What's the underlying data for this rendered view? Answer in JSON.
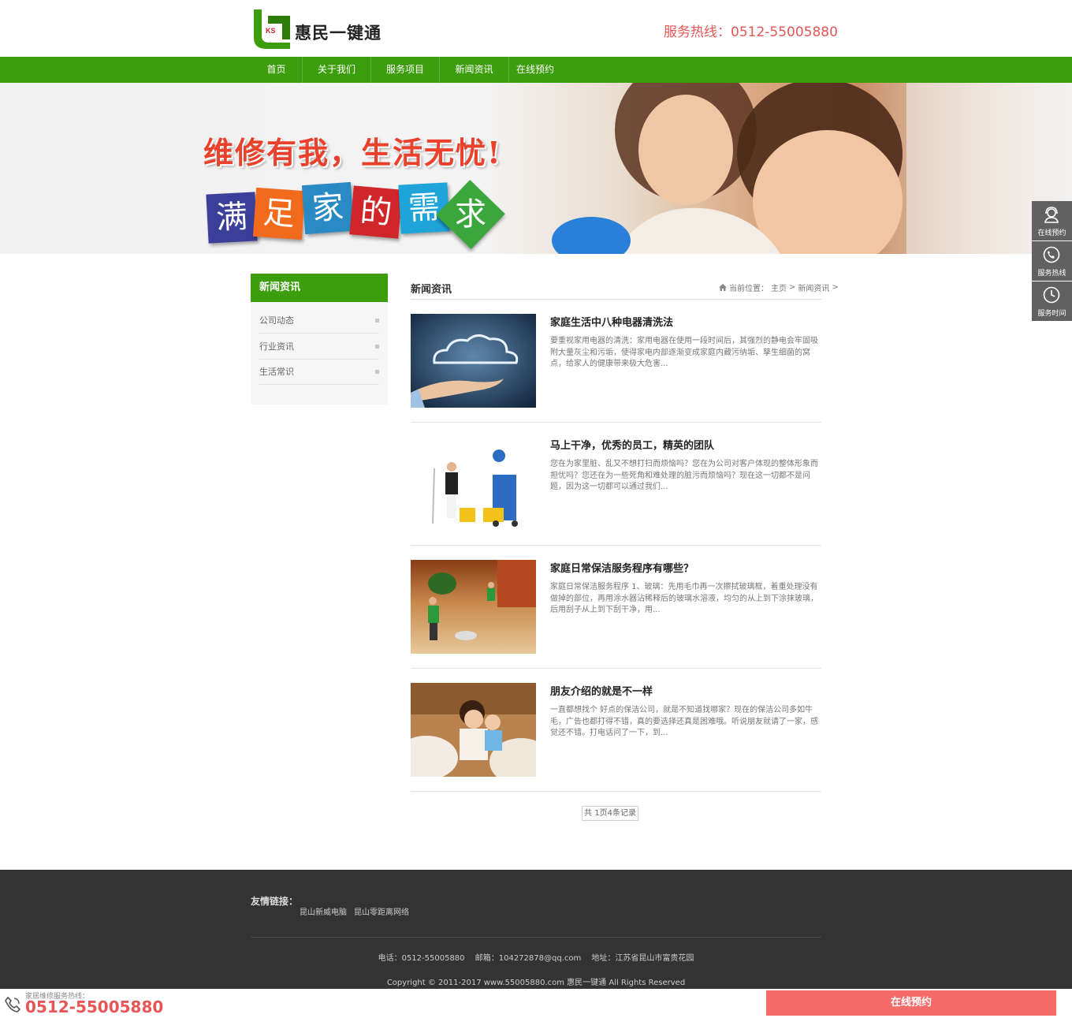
{
  "header": {
    "logo_text": "惠民一键通",
    "logo_badge": "KS",
    "hotline": "服务热线：0512-55005880"
  },
  "nav": {
    "items": [
      {
        "label": "首页"
      },
      {
        "label": "关于我们"
      },
      {
        "label": "服务项目"
      },
      {
        "label": "新闻资讯"
      },
      {
        "label": "在线预约"
      }
    ],
    "color": "#3c9d0d"
  },
  "banner": {
    "slogan": "维修有我，生活无忧!",
    "tiles": [
      "满",
      "足",
      "家",
      "的",
      "需",
      "求"
    ],
    "tile_colors": [
      "#3b3f9a",
      "#f26a1b",
      "#2a8bc4",
      "#d0262a",
      "#1ea4d8",
      "#3aa63c"
    ]
  },
  "sidebar": {
    "title": "新闻资讯",
    "items": [
      {
        "label": "公司动态"
      },
      {
        "label": "行业资讯"
      },
      {
        "label": "生活常识"
      }
    ]
  },
  "content": {
    "title": "新闻资讯",
    "breadcrumb": {
      "prefix": "当前位置：",
      "home": "主页",
      "sep": ">",
      "current": "新闻资讯"
    },
    "articles": [
      {
        "title": "家庭生活中八种电器清洗法",
        "desc": "要重视家用电器的清洗：家用电器在使用一段时间后，其强烈的静电会牢固吸附大量灰尘和污垢，使得家电内部逐渐变成家庭内藏污纳垢、孳生细菌的窝点，给家人的健康带来极大危害..."
      },
      {
        "title": "马上干净，优秀的员工，精英的团队",
        "desc": "您在为家里脏、乱又不想打扫而烦恼吗？您在为公司对客户体现的整体形象而担忧吗？您还在为一些死角和难处理的脏污而烦恼吗？现在这一切都不是问题，因为这一切都可以通过我们..."
      },
      {
        "title": "家庭日常保洁服务程序有哪些？",
        "desc": "家庭日常保洁服务程序 1、玻璃：先用毛巾再一次擦拭玻璃框，着重处理没有做掉的部位，再用涂水器沾稀释后的玻璃水溶液，均匀的从上到下涂抹玻璃，后用刮子从上到下刮干净，用..."
      },
      {
        "title": "朋友介绍的就是不一样",
        "desc": "一直都想找个 好点的保洁公司，就是不知道找哪家？现在的保洁公司多如牛毛，广告也都打得不错，真的要选择还真是困难哦。听说朋友就请了一家，感觉还不错。打电话问了一下，到..."
      }
    ],
    "pager": "共 1页4条记录"
  },
  "footer": {
    "friend_label": "友情链接：",
    "friend_links": [
      "昆山新威电脑",
      "昆山零距离网络"
    ],
    "phone": "电话：0512-55005880",
    "email": "邮箱：104272878@qq.com",
    "address": "地址：江苏省昆山市富贵花园",
    "copyright": "Copyright © 2011-2017 www.55005880.com 惠民一键通 All Rights Reserved"
  },
  "bottom_bar": {
    "label": "家居维修服务热线：",
    "phone": "0512-55005880",
    "button": "在线预约"
  },
  "float": {
    "items": [
      {
        "label": "在线预约",
        "icon": "customer-service-icon"
      },
      {
        "label": "服务热线",
        "icon": "phone-icon"
      },
      {
        "label": "服务时间",
        "icon": "clock-icon"
      }
    ]
  }
}
